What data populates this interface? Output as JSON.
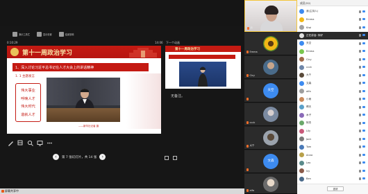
{
  "toolbar": {
    "buttons": [
      {
        "label": "演示工具栏"
      },
      {
        "label": "显示设置"
      },
      {
        "label": "结束放映"
      }
    ],
    "elapsed": "0:10:29",
    "clock": "14:06",
    "next_label": "下一个动画"
  },
  "slide": {
    "title": "第十一周政治学习",
    "subtitle": "1、深入讨论习近平总书记在人才大会上的讲话精神",
    "point": "1. 1  主题发言",
    "box_lines": [
      "伟大事业",
      "呼唤人才",
      "伟大时代",
      "造就人才"
    ],
    "caption": "——新华社记者 摄"
  },
  "next_slide": {
    "title": "第十一周政治学习"
  },
  "notes": "无备注。",
  "nav": {
    "prev": "‹",
    "next": "›",
    "page_text": "第 7 张幻灯片，共 14 张"
  },
  "taskbar": {
    "label": "屏幕共享中"
  },
  "videos": [
    {
      "name": "我",
      "kind": "camera"
    },
    {
      "name": "Emma",
      "kind": "sun"
    },
    {
      "name": "Cicy",
      "kind": "photo1"
    },
    {
      "name": "天空",
      "kind": "blue"
    },
    {
      "name": "ccck",
      "kind": "photo2"
    },
    {
      "name": "大千",
      "kind": "photo3"
    },
    {
      "name": "文森",
      "kind": "blue"
    },
    {
      "name": "alfa",
      "kind": "photo4"
    }
  ],
  "members": {
    "header": "成员(52)",
    "rows": [
      {
        "name": "我(主持人)",
        "color": "#3d8bf0"
      },
      {
        "name": "Emma",
        "color": "#f2b816"
      },
      {
        "name": "Kiwi",
        "color": "#a0a0a0"
      },
      {
        "name": "正在讲话: 你好",
        "color": "#e0e0e0",
        "highlight": true
      },
      {
        "name": "天空",
        "color": "#3d8bf0"
      },
      {
        "name": "Emma",
        "color": "#7ac74f"
      },
      {
        "name": "Cicy",
        "color": "#a06a4a"
      },
      {
        "name": "ccck",
        "color": "#6e86a8"
      },
      {
        "name": "大千",
        "color": "#5a4a3a"
      },
      {
        "name": "文森",
        "color": "#3d8bf0"
      },
      {
        "name": "alfa",
        "color": "#9e9e9e"
      },
      {
        "name": "小雨",
        "color": "#c98a5a"
      },
      {
        "name": "晴天",
        "color": "#5aa0c9"
      },
      {
        "name": "木子",
        "color": "#8a6ab8"
      },
      {
        "name": "阿杰",
        "color": "#6aa86a"
      },
      {
        "name": "Lily",
        "color": "#c95a7a"
      },
      {
        "name": "Jack",
        "color": "#7a7a7a"
      },
      {
        "name": "Tom",
        "color": "#4a7ab8"
      },
      {
        "name": "Anna",
        "color": "#b8a04a"
      },
      {
        "name": "Leo",
        "color": "#5a8a8a"
      },
      {
        "name": "Ivy",
        "color": "#8a5a4a"
      },
      {
        "name": "Ben",
        "color": "#4a6a8a"
      }
    ],
    "footer_button": "邀请"
  }
}
